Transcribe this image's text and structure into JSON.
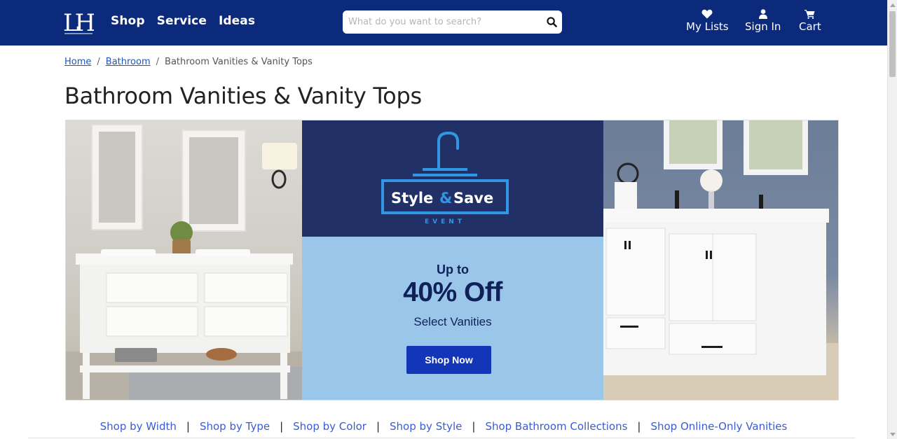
{
  "header": {
    "logo_text": "LH",
    "nav": [
      {
        "label": "Shop"
      },
      {
        "label": "Service"
      },
      {
        "label": "Ideas"
      }
    ],
    "search": {
      "placeholder": "What do you want to search?"
    },
    "actions": {
      "lists": "My Lists",
      "signin": "Sign In",
      "cart": "Cart"
    },
    "bg_color": "#0b2a7c"
  },
  "breadcrumb": {
    "home": "Home",
    "bathroom": "Bathroom",
    "current": "Bathroom Vanities & Vanity Tops"
  },
  "page_title": "Bathroom Vanities & Vanity Tops",
  "banner": {
    "event_brand_1": "Style",
    "event_brand_amp": "&",
    "event_brand_2": "Save",
    "event_tag": "EVENT",
    "upto": "Up to",
    "discount": "40% Off",
    "subtitle": "Select Vanities",
    "cta": "Shop Now",
    "colors": {
      "navy": "#213066",
      "light_blue": "#99c6e9",
      "cta": "#1335b8"
    }
  },
  "category_links": [
    {
      "label": "Shop by Width"
    },
    {
      "label": "Shop by Type"
    },
    {
      "label": "Shop by Color"
    },
    {
      "label": "Shop by Style"
    },
    {
      "label": "Shop Bathroom Collections"
    },
    {
      "label": "Shop Online-Only Vanities"
    }
  ],
  "icons": {
    "search": "search-icon",
    "lists": "heart-icon",
    "signin": "user-icon",
    "cart": "cart-icon"
  }
}
